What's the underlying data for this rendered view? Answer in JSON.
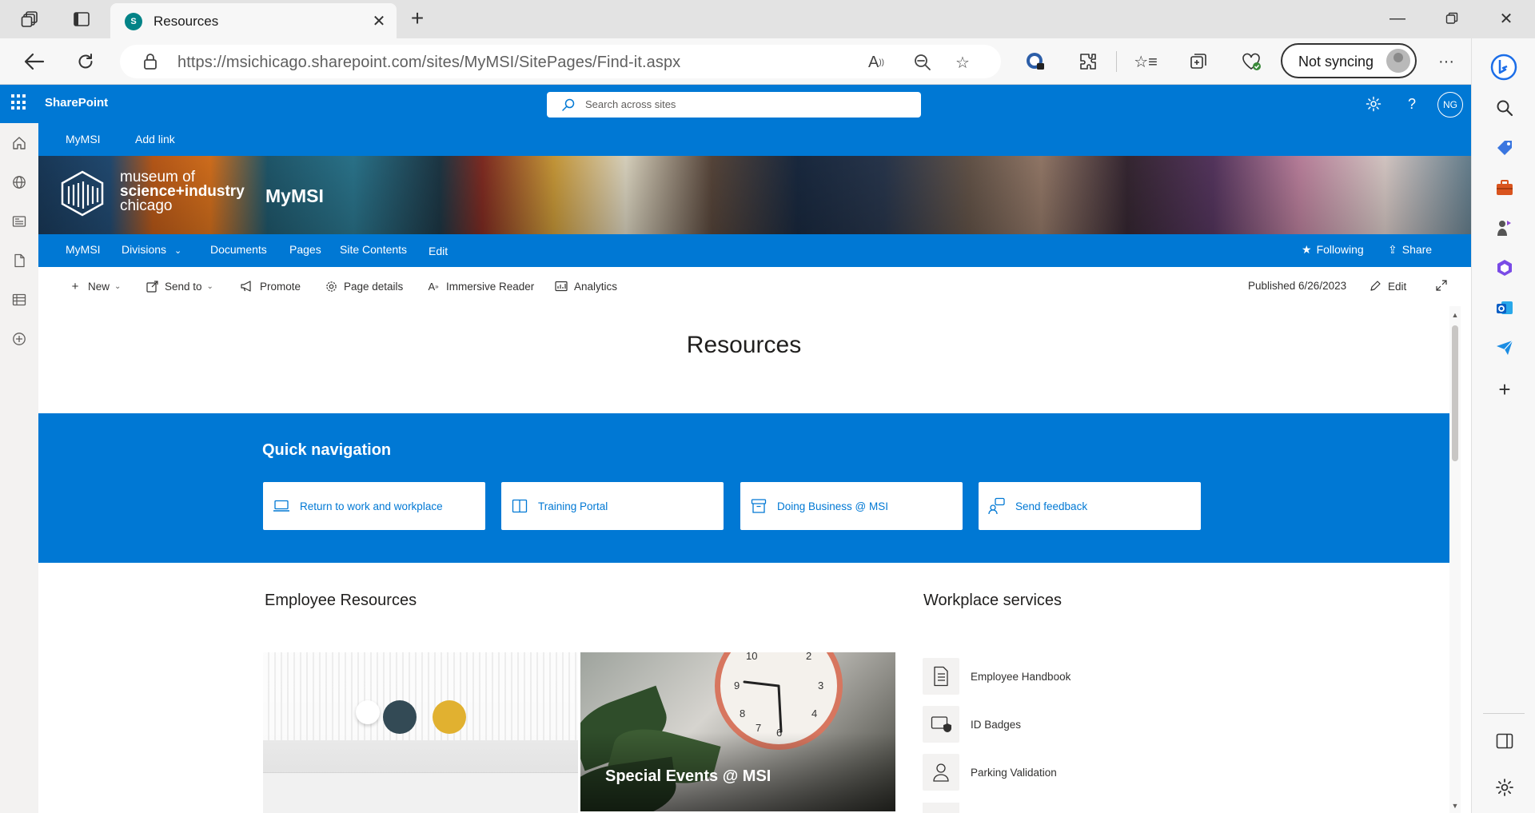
{
  "browser": {
    "tab_title": "Resources",
    "tab_favicon_text": "S",
    "url_host": "https://msichicago.sharepoint.com",
    "url_path": "/sites/MyMSI/SitePages/Find-it.aspx",
    "sync_label": "Not syncing"
  },
  "suitebar": {
    "brand": "SharePoint",
    "search_placeholder": "Search across sites",
    "avatar_initials": "NG"
  },
  "hubnav": {
    "items": [
      "MyMSI",
      "Add link"
    ]
  },
  "banner": {
    "logo_line1": "museum of",
    "logo_line2": "science+industry",
    "logo_line3": "chicago",
    "site_title": "MyMSI"
  },
  "sitenav": {
    "items": [
      "MyMSI",
      "Divisions",
      "Documents",
      "Pages",
      "Site Contents",
      "Edit"
    ],
    "following": "Following",
    "share": "Share"
  },
  "commandbar": {
    "new": "New",
    "send_to": "Send to",
    "promote": "Promote",
    "page_details": "Page details",
    "immersive_reader": "Immersive Reader",
    "analytics": "Analytics",
    "published": "Published 6/26/2023",
    "edit": "Edit"
  },
  "page": {
    "title": "Resources",
    "quick_nav_title": "Quick navigation",
    "quick_links": [
      {
        "label": "Return to work and workplace",
        "icon": "laptop-icon"
      },
      {
        "label": "Training Portal",
        "icon": "book-icon"
      },
      {
        "label": "Doing Business @ MSI",
        "icon": "archive-icon"
      },
      {
        "label": "Send feedback",
        "icon": "feedback-icon"
      }
    ],
    "employee_resources_title": "Employee Resources",
    "tile2_label": "Special Events @ MSI",
    "workplace_title": "Workplace services",
    "workplace_items": [
      "Employee Handbook",
      "ID Badges",
      "Parking Validation"
    ]
  },
  "colors": {
    "accent": "#0078d4",
    "chrome": "#e3e3e3"
  }
}
